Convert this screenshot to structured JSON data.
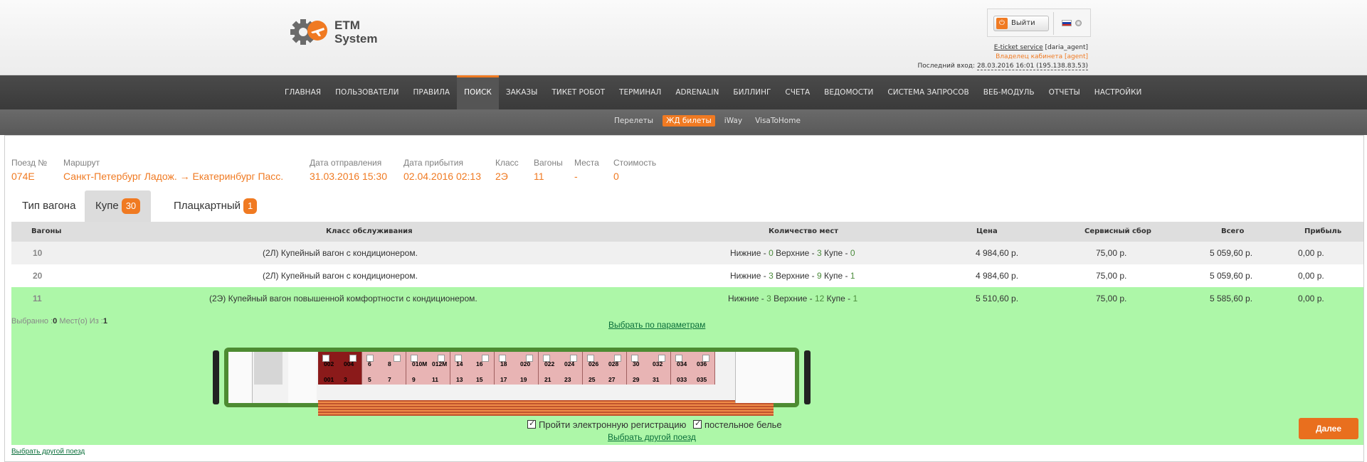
{
  "header": {
    "logo_text_1": "ETM",
    "logo_text_2": "System",
    "logout_label": "Выйти",
    "service_text": "E-ticket service",
    "service_user": "[daria_agent]",
    "owner_text": "Владелец кабинета [agent]",
    "last_login_label": "Последний вход:",
    "last_login_value": "28.03.2016 16:01 (195.138.83.53)"
  },
  "main_nav": [
    "ГЛАВНАЯ",
    "ПОЛЬЗОВАТЕЛИ",
    "ПРАВИЛА",
    "ПОИСК",
    "ЗАКАЗЫ",
    "ТИКЕТ РОБОТ",
    "ТЕРМИНАЛ",
    "ADRENALIN",
    "БИЛЛИНГ",
    "СЧЕТА",
    "ВЕДОМОСТИ",
    "СИСТЕМА ЗАПРОСОВ",
    "ВЕБ-МОДУЛЬ",
    "ОТЧЕТЫ",
    "НАСТРОЙКИ"
  ],
  "main_nav_active": "ПОИСК",
  "sub_nav": [
    "Перелеты",
    "ЖД билеты",
    "iWay",
    "VisaToHome"
  ],
  "sub_nav_active": "ЖД билеты",
  "train": {
    "number_label": "Поезд №",
    "number": "074Е",
    "route_label": "Маршрут",
    "route": "Санкт-Петербург Ладож. → Екатеринбург Пасс.",
    "departure_label": "Дата отправления",
    "departure": "31.03.2016 15:30",
    "arrival_label": "Дата прибытия",
    "arrival": "02.04.2016 02:13",
    "class_label": "Класс",
    "class": "2Э",
    "wagons_label": "Вагоны",
    "wagons": "11",
    "seats_label": "Места",
    "seats": "-",
    "cost_label": "Стоимость",
    "cost": "0"
  },
  "tabs": {
    "type_label": "Тип вагона",
    "kupe_label": "Купе",
    "kupe_count": "30",
    "plats_label": "Плацкартный",
    "plats_count": "1"
  },
  "table": {
    "headers": {
      "wagons": "Вагоны",
      "service_class": "Класс обслуживания",
      "seat_count": "Количество мест",
      "price": "Цена",
      "service_fee": "Сервисный сбор",
      "total": "Всего",
      "profit": "Прибыль"
    },
    "rows": [
      {
        "wagon": "10",
        "class_code": "(2Л)",
        "class_desc": "Купейный вагон с кондиционером.",
        "lower": "0",
        "upper": "3",
        "kupe": "0",
        "price": "4 984,60 р.",
        "fee": "75,00 р.",
        "total": "5 059,60 р.",
        "profit": "0,00 р."
      },
      {
        "wagon": "20",
        "class_code": "(2Л)",
        "class_desc": "Купейный вагон с кондиционером.",
        "lower": "3",
        "upper": "9",
        "kupe": "1",
        "price": "4 984,60 р.",
        "fee": "75,00 р.",
        "total": "5 059,60 р.",
        "profit": "0,00 р."
      },
      {
        "wagon": "11",
        "class_code": "(2Э)",
        "class_desc": "Купейный вагон повышенной комфортности с кондиционером.",
        "lower": "3",
        "upper": "12",
        "kupe": "1",
        "price": "5 510,60 р.",
        "fee": "75,00 р.",
        "total": "5 585,60 р.",
        "profit": "0,00 р."
      }
    ],
    "seat_words": {
      "lower": "Нижние - ",
      "upper": " Верхние - ",
      "kupe": " Купе - "
    }
  },
  "selection": {
    "selected_label": "Выбранно :",
    "selected_count": "0",
    "of_label": " Мест(о) Из :",
    "of_count": "1",
    "by_params_link": "Выбрать по параметрам",
    "upper_seats": [
      "002",
      "004",
      "6",
      "8",
      "010М",
      "012М",
      "14",
      "16",
      "18",
      "020",
      "022",
      "024",
      "026",
      "028",
      "30",
      "032",
      "034",
      "036"
    ],
    "lower_seats": [
      "001",
      "3",
      "5",
      "7",
      "9",
      "11",
      "13",
      "15",
      "17",
      "19",
      "21",
      "23",
      "25",
      "27",
      "29",
      "31",
      "033",
      "035"
    ],
    "e_registration_label": "Пройти электронную регистрацию",
    "linen_label": "постельное белье",
    "choose_other_train_link": "Выбрать другой поезд",
    "next_button": "Далее"
  },
  "bottom_link": "Выбрать другой поезд"
}
